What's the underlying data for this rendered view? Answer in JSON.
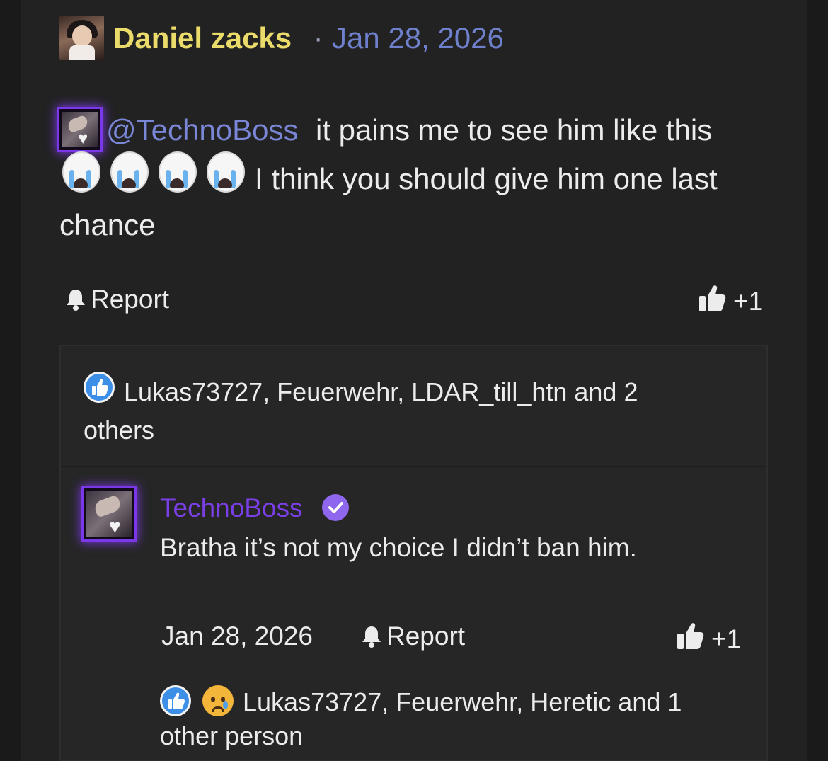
{
  "post": {
    "author": "Daniel zacks",
    "separator": "·",
    "date": "Jan 28, 2026",
    "mention": "@TechnoBoss",
    "text_part1": "it pains me to see him like this",
    "text_part2": "I think you should give him one last",
    "text_part3": "chance",
    "report_label": "Report",
    "like_count": "+1",
    "reactors": "Lukas73727, Feuerwehr, LDAR_till_htn and 2 others"
  },
  "reply": {
    "author": "TechnoBoss",
    "text": "Bratha it’s not my choice I didn’t ban him.",
    "date": "Jan 28, 2026",
    "report_label": "Report",
    "like_count": "+1",
    "reactors": "Lukas73727, Feuerwehr, Heretic and 1 other person"
  },
  "colors": {
    "author": "#eadb6a",
    "date": "#6f80cc",
    "mention": "#7a86d6",
    "reply_author": "#7a3fe6",
    "verified": "#8f66ee",
    "like_badge": "#3d8ee6"
  },
  "icons": [
    "bell-icon",
    "thumbs-up-icon",
    "like-reaction-icon",
    "sad-reaction-icon",
    "verified-check-icon",
    "crying-emoji"
  ]
}
